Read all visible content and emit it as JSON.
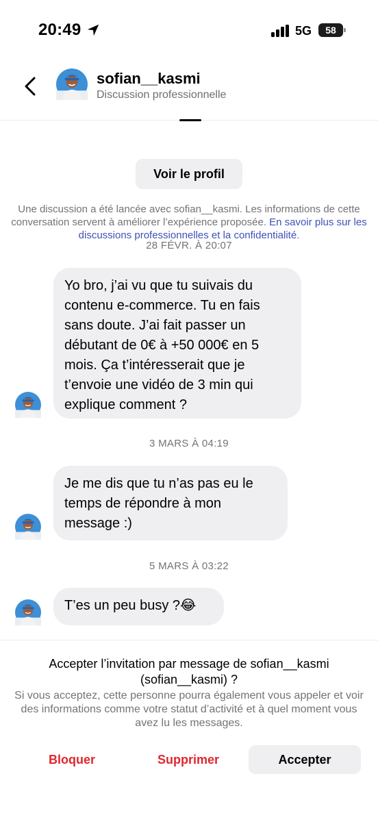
{
  "status_bar": {
    "time": "20:49",
    "network": "5G",
    "battery": "58"
  },
  "header": {
    "name": "sofian__kasmi",
    "subtitle": "Discussion professionnelle"
  },
  "profile_button": "Voir le profil",
  "notice": {
    "text": "Une discussion a été lancée avec sofian__kasmi. Les informations de cette conversation servent à améliorer l’expérience proposée.",
    "link": "En savoir plus sur les discussions professionnelles et la confidentialité",
    "period": "."
  },
  "messages": [
    {
      "date": "28 FÉVR. À 20:07",
      "text": "Yo bro, j’ai vu que tu suivais du contenu e-commerce. Tu en fais sans doute. J’ai fait passer un débutant de 0€ à +50 000€ en 5 mois. Ça t’intéresserait que je t’envoie une vidéo de 3 min qui explique comment ?"
    },
    {
      "date": "3 MARS À 04:19",
      "text": "Je me dis que tu n’as pas eu le temps de répondre à mon message :)"
    },
    {
      "date": "5 MARS À 03:22",
      "text": "T’es un peu busy ?😂"
    }
  ],
  "invite": {
    "title": "Accepter l’invitation par message de sofian__kasmi (sofian__kasmi) ?",
    "description": "Si vous acceptez, cette personne pourra également vous appeler et voir des informations comme votre statut d’activité et à quel moment vous avez lu les messages."
  },
  "actions": {
    "block": "Bloquer",
    "delete": "Supprimer",
    "accept": "Accepter"
  },
  "colors": {
    "destructive": "#e0262d",
    "link": "#3f51b5",
    "bubble": "#efeff1",
    "avatar_bg": "#3d8fd6"
  }
}
